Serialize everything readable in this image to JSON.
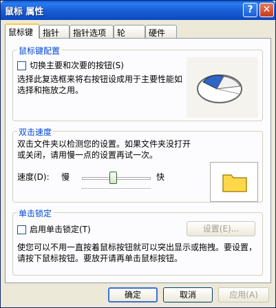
{
  "window": {
    "title": "鼠标 属性"
  },
  "tabs": [
    "鼠标键",
    "指针",
    "指针选项",
    "轮",
    "硬件"
  ],
  "button_config": {
    "title": "鼠标键配置",
    "switch_label": "切换主要和次要的按钮(S)",
    "description": "选择此复选框来将右按钮设成用于主要性能如选择和拖放之用。"
  },
  "double_click": {
    "title": "双击速度",
    "description": "双击文件夹以检测您的设置。如果文件夹没打开或关闭，请用慢一点的设置再试一次。",
    "speed_label": "速度(D):",
    "slow_label": "慢",
    "fast_label": "快",
    "speed_value": 0.45
  },
  "click_lock": {
    "title": "单击锁定",
    "enable_label": "启用单击锁定(T)",
    "settings_label": "设置(E)...",
    "description": "使您可以不用一直按着鼠标按钮就可以突出显示或拖拽。要设置，请按下鼠标按钮。要放开请再单击鼠标按钮。"
  },
  "footer": {
    "ok_label": "确定",
    "cancel_label": "取消",
    "apply_label": "应用(A)"
  },
  "colors": {
    "titlebar": "#0a5fd8",
    "group_title": "#0046d5",
    "tab_highlight": "#ffc83c"
  }
}
